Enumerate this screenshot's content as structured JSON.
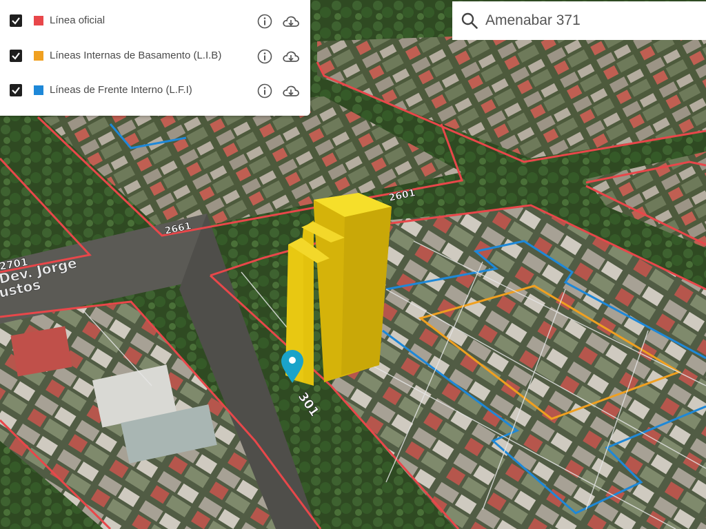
{
  "layers": [
    {
      "label": "Línea oficial",
      "color": "#e8474a",
      "checked": true,
      "info_icon": "info-icon",
      "download_icon": "cloud-download-icon"
    },
    {
      "label": "Líneas Internas de Basamento (L.I.B)",
      "color": "#f0a020",
      "checked": true,
      "info_icon": "info-icon",
      "download_icon": "cloud-download-icon"
    },
    {
      "label": "Líneas de Frente Interno (L.F.I)",
      "color": "#1e88d8",
      "checked": true,
      "info_icon": "info-icon",
      "download_icon": "cloud-download-icon"
    }
  ],
  "search": {
    "value": "Amenabar 371",
    "icon": "search-icon"
  },
  "map": {
    "street_labels": [
      "Dev. Jorge",
      "ustos"
    ],
    "block_numbers": [
      "2701",
      "2661",
      "2601",
      "301"
    ],
    "colors": {
      "official_line": "#e8474a",
      "lib_line": "#f0a020",
      "lfi_line": "#1e88d8",
      "building": "#f2cd10",
      "marker": "#1aa3c9"
    }
  }
}
